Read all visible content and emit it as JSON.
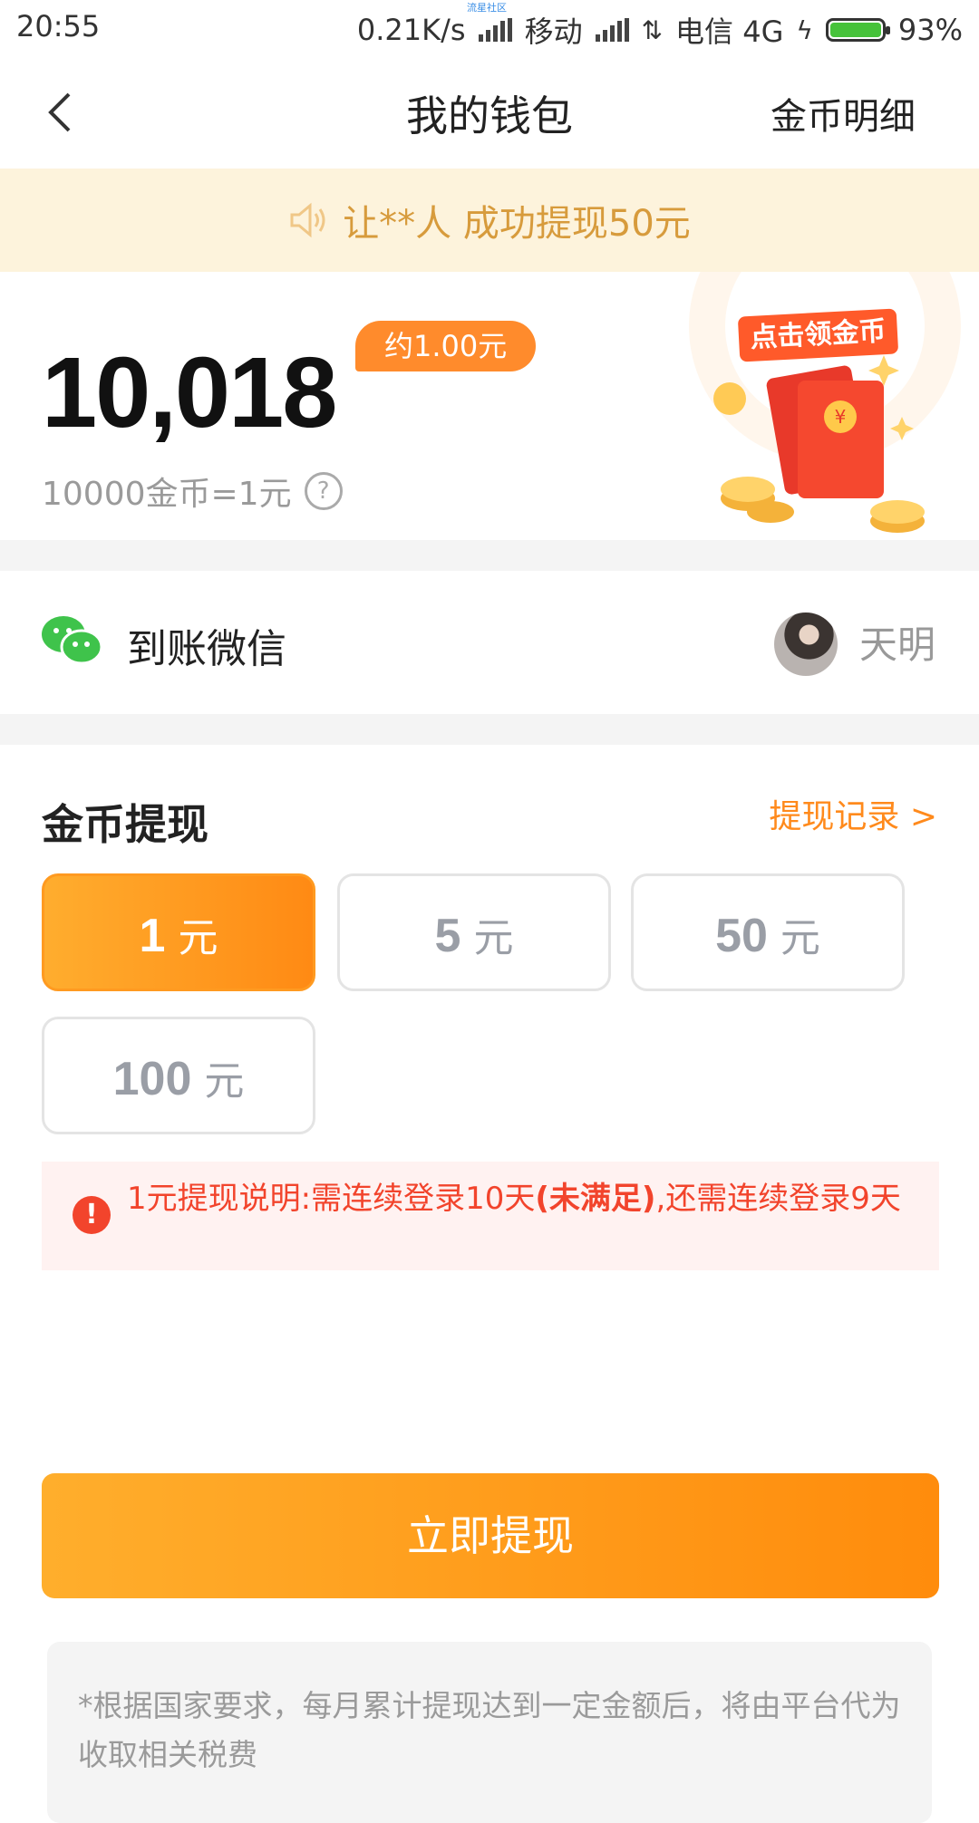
{
  "status_bar": {
    "time": "20:55",
    "speed": "0.21K/s",
    "carrier1": "移动",
    "carrier2": "电信 4G",
    "battery": "93%",
    "watermark": "流星社区"
  },
  "header": {
    "title": "我的钱包",
    "right_link": "金币明细"
  },
  "announcement": {
    "text": "让**人 成功提现50元"
  },
  "balance": {
    "coins": "10,018",
    "approx": "约1.00元",
    "rate": "10000金币=1元",
    "promo_label": "点击领金币"
  },
  "payee": {
    "label": "到账微信",
    "name": "天明"
  },
  "withdraw": {
    "title": "金币提现",
    "record_link": "提现记录 >",
    "options": [
      {
        "amount": "1",
        "unit": "元"
      },
      {
        "amount": "5",
        "unit": "元"
      },
      {
        "amount": "50",
        "unit": "元"
      },
      {
        "amount": "100",
        "unit": "元"
      }
    ],
    "selected_index": 0,
    "notice_prefix": "1元提现说明:需连续登录10天",
    "notice_bold": "(未满足)",
    "notice_suffix": ",还需连续登录9天",
    "submit": "立即提现",
    "disclaimer": "*根据国家要求，每月累计提现达到一定金额后，将由平台代为收取相关税费"
  },
  "colors": {
    "accent": "#ff8c0c",
    "warning": "#f2442c",
    "announce_bg": "#fdf3dc",
    "wechat": "#3fc34b"
  }
}
